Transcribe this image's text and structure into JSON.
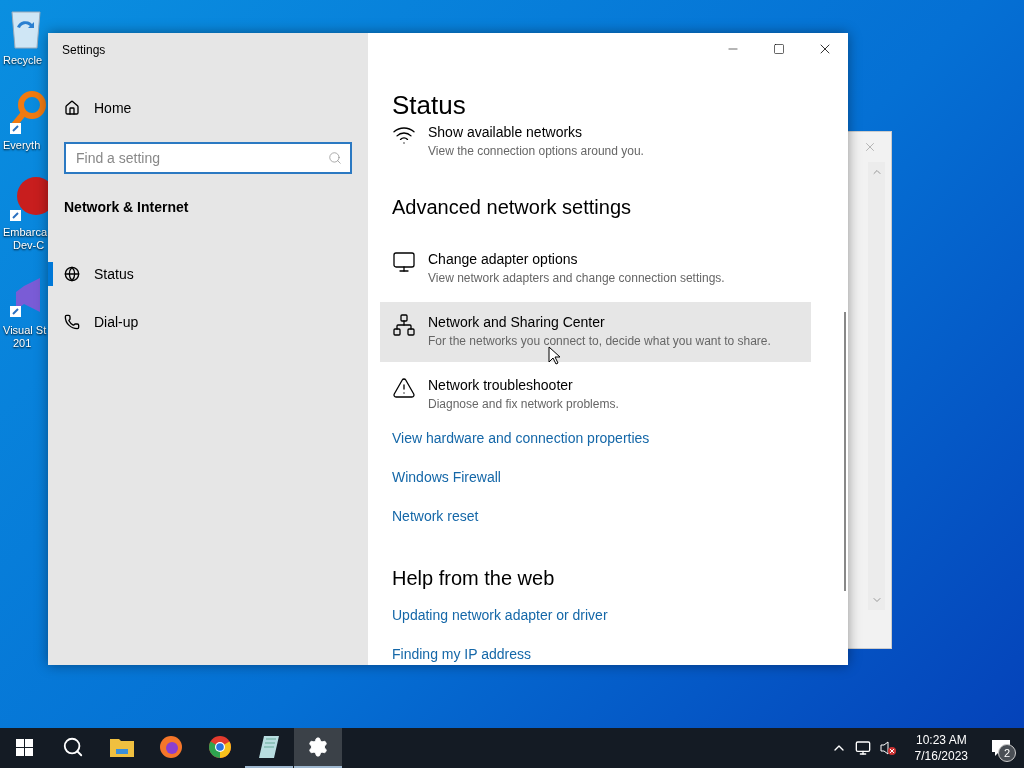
{
  "desktop_icons": [
    {
      "kind": "recycle-bin",
      "lines": [
        "Recycle"
      ]
    },
    {
      "kind": "magnifier-shortcut",
      "lines": [
        "Everyth"
      ]
    },
    {
      "kind": "dev-shortcut",
      "lines": [
        "Embarca",
        "Dev-C"
      ]
    },
    {
      "kind": "studio-shortcut",
      "lines": [
        "Visual St",
        "201"
      ]
    }
  ],
  "window": {
    "title": "Settings"
  },
  "sidebar": {
    "home": "Home",
    "search": {
      "placeholder": "Find a setting"
    },
    "section": "Network & Internet",
    "items": [
      {
        "label": "Status",
        "selected": true
      },
      {
        "label": "Dial-up",
        "selected": false
      }
    ]
  },
  "content": {
    "title": "Status",
    "top_item": {
      "title": "Show available networks",
      "description": "View the connection options around you."
    },
    "sections": [
      {
        "heading": "Advanced network settings",
        "items": [
          {
            "kind": "entry",
            "title": "Change adapter options",
            "description": "View network adapters and change connection settings.",
            "highlighted": false
          },
          {
            "kind": "entry",
            "title": "Network and Sharing Center",
            "description": "For the networks you connect to, decide what you want to share.",
            "highlighted": true
          },
          {
            "kind": "entry",
            "title": "Network troubleshooter",
            "description": "Diagnose and fix network problems.",
            "highlighted": false
          },
          {
            "kind": "link",
            "label": "View hardware and connection properties"
          },
          {
            "kind": "link",
            "label": "Windows Firewall"
          },
          {
            "kind": "link",
            "label": "Network reset"
          }
        ]
      },
      {
        "heading": "Help from the web",
        "items": [
          {
            "kind": "link",
            "label": "Updating network adapter or driver"
          },
          {
            "kind": "link",
            "label": "Finding my IP address"
          }
        ]
      }
    ]
  },
  "taskbar": {
    "apps": [
      {
        "kind": "start",
        "running": false,
        "active": false
      },
      {
        "kind": "search",
        "running": false,
        "active": false
      },
      {
        "kind": "folder",
        "running": false,
        "active": false
      },
      {
        "kind": "fox",
        "running": false,
        "active": false
      },
      {
        "kind": "chrome",
        "running": false,
        "active": false
      },
      {
        "kind": "notepad",
        "running": true,
        "active": false
      },
      {
        "kind": "settings",
        "running": true,
        "active": true
      }
    ],
    "time": "10:23 AM",
    "date": "7/16/2023",
    "notifications": "2"
  }
}
